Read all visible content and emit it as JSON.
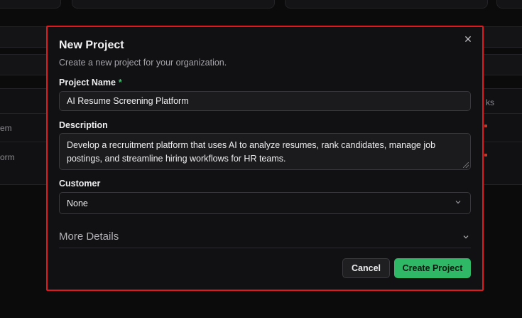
{
  "background": {
    "rows": [
      {
        "left_text": "em",
        "right_text": ""
      },
      {
        "left_text": "orm",
        "right_text": ""
      }
    ],
    "header_right_text": "ks"
  },
  "modal": {
    "title": "New Project",
    "subtitle": "Create a new project for your organization.",
    "close_icon": "✕",
    "project_name": {
      "label": "Project Name",
      "required_marker": "*",
      "value": "AI Resume Screening Platform"
    },
    "description": {
      "label": "Description",
      "value": "Develop a recruitment platform that uses AI to analyze resumes, rank candidates, manage job postings, and streamline hiring workflows for HR teams."
    },
    "customer": {
      "label": "Customer",
      "selected": "None"
    },
    "more_details": {
      "label": "More Details"
    },
    "buttons": {
      "cancel": "Cancel",
      "create": "Create Project"
    }
  },
  "colors": {
    "accent_green": "#2fb866",
    "highlight_border": "#e0191f",
    "modal_bg": "#111113"
  }
}
